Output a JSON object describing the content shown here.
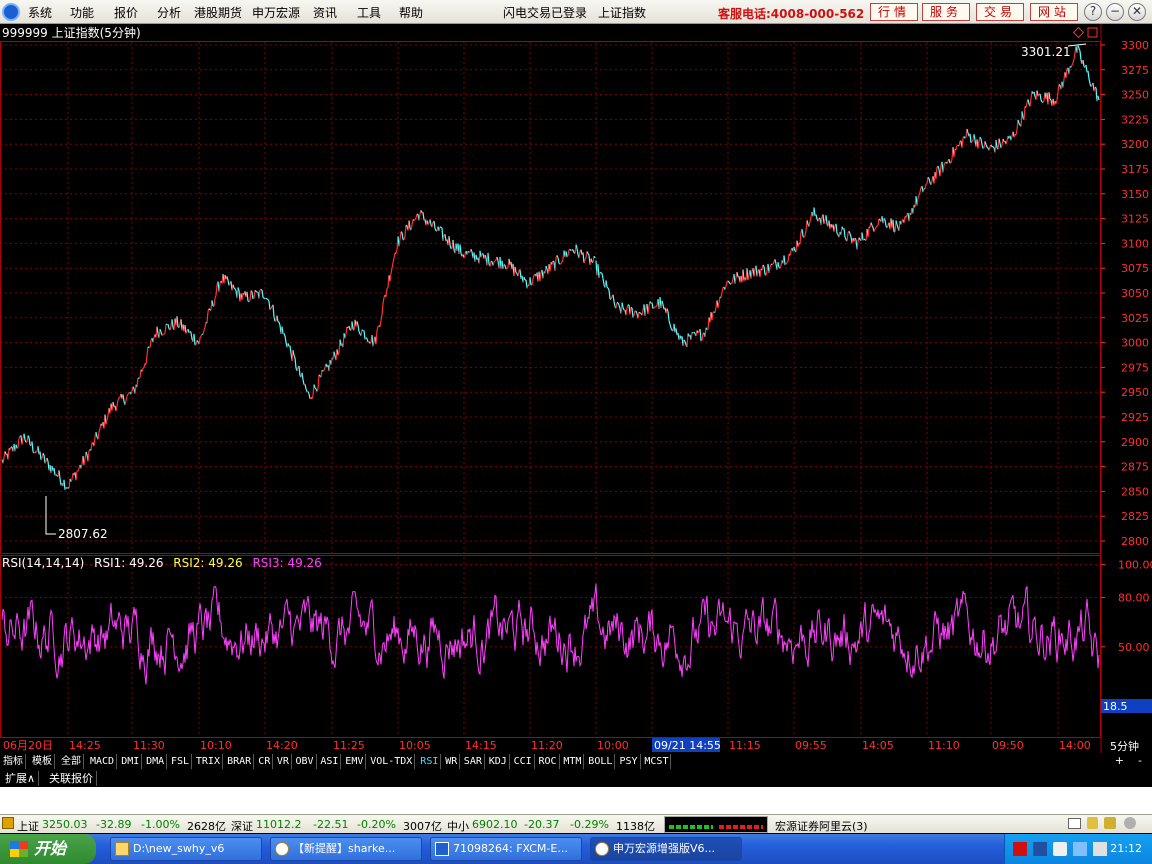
{
  "menubar": {
    "items": [
      "系统",
      "功能",
      "报价",
      "分析",
      "港股期货",
      "申万宏源",
      "资讯",
      "工具",
      "帮助"
    ],
    "status": [
      "闪电交易已登录",
      "上证指数"
    ],
    "hotline": "客服电话:4008-000-562",
    "buttons": [
      "行情",
      "服务",
      "交易",
      "网站"
    ],
    "win_buttons": [
      "?",
      "−",
      "❐",
      "✕"
    ]
  },
  "chart": {
    "title": "999999 上证指数(5分钟)",
    "y_ticks": [
      "3300",
      "3275",
      "3250",
      "3225",
      "3200",
      "3175",
      "3150",
      "3125",
      "3100",
      "3075",
      "3050",
      "3025",
      "3000",
      "2975",
      "2950",
      "2925",
      "2900",
      "2875",
      "2850",
      "2825",
      "2800"
    ],
    "max_label": "3301.21",
    "min_label": "2807.62",
    "indicator_header": {
      "name": "RSI(14,14,14)",
      "rsi1": "RSI1: 49.26",
      "rsi2": "RSI2: 49.26",
      "rsi3": "RSI3: 49.26"
    },
    "rsi_ticks": [
      "100.00",
      "80.00",
      "50.00"
    ],
    "rsi_current": "18.5",
    "x_labels": [
      "06月20日",
      "14:25",
      "11:30",
      "10:10",
      "14:20",
      "11:25",
      "10:05",
      "14:15",
      "11:20",
      "10:00",
      "09/21 14:55",
      "11:15",
      "09:55",
      "14:05",
      "11:10",
      "09:50",
      "14:00"
    ],
    "period": "5分钟",
    "colors": {
      "up": "#ff3030",
      "down": "#54ffff",
      "rsi": "#ff40ff",
      "grid": "#800000"
    }
  },
  "chart_data": {
    "type": "line",
    "title": "999999 上证指数(5分钟)",
    "ylim": [
      2800,
      3300
    ],
    "price_series_approx": [
      2880,
      2905,
      2880,
      2855,
      2890,
      2935,
      2950,
      3010,
      3020,
      3000,
      3065,
      3045,
      3050,
      3000,
      2945,
      2980,
      3020,
      3000,
      3100,
      3130,
      3110,
      3090,
      3085,
      3080,
      3060,
      3075,
      3095,
      3080,
      3035,
      3030,
      3040,
      3000,
      3010,
      3060,
      3070,
      3075,
      3090,
      3130,
      3115,
      3100,
      3125,
      3115,
      3155,
      3180,
      3210,
      3195,
      3205,
      3250,
      3245,
      3295,
      3245
    ],
    "max": 3301.21,
    "min": 2807.62,
    "rsi": {
      "params": [
        14,
        14,
        14
      ],
      "rsi1": 49.26,
      "rsi2": 49.26,
      "rsi3": 49.26,
      "last": 18.5,
      "ylim": [
        0,
        100
      ]
    }
  },
  "tabs": [
    "指标",
    "模板",
    "全部",
    "MACD",
    "DMI",
    "DMA",
    "FSL",
    "TRIX",
    "BRAR",
    "CR",
    "VR",
    "OBV",
    "ASI",
    "EMV",
    "VOL-TDX",
    "RSI",
    "WR",
    "SAR",
    "KDJ",
    "CCI",
    "ROC",
    "MTM",
    "BOLL",
    "PSY",
    "MCST"
  ],
  "selected_tab": "RSI",
  "ext_tabs": [
    "扩展∧",
    "关联报价"
  ],
  "statusbar": {
    "sh": {
      "name": "上证",
      "value": "3250.03",
      "change": "-32.89",
      "pct": "-1.00%",
      "amount": "2628亿"
    },
    "sz": {
      "name": "深证",
      "value": "11012.2",
      "change": "-22.51",
      "pct": "-0.20%",
      "amount": "3007亿"
    },
    "zx": {
      "name": "中小",
      "value": "6902.10",
      "change": "-20.37",
      "pct": "-0.29%",
      "amount": "1138亿"
    },
    "server": "宏源证券阿里云(3)"
  },
  "taskbar": {
    "start": "开始",
    "tasks": [
      "D:\\new_swhy_v6",
      "【新提醒】sharke...",
      "71098264: FXCM-E...",
      "申万宏源增强版V6..."
    ],
    "clock": "21:12"
  }
}
